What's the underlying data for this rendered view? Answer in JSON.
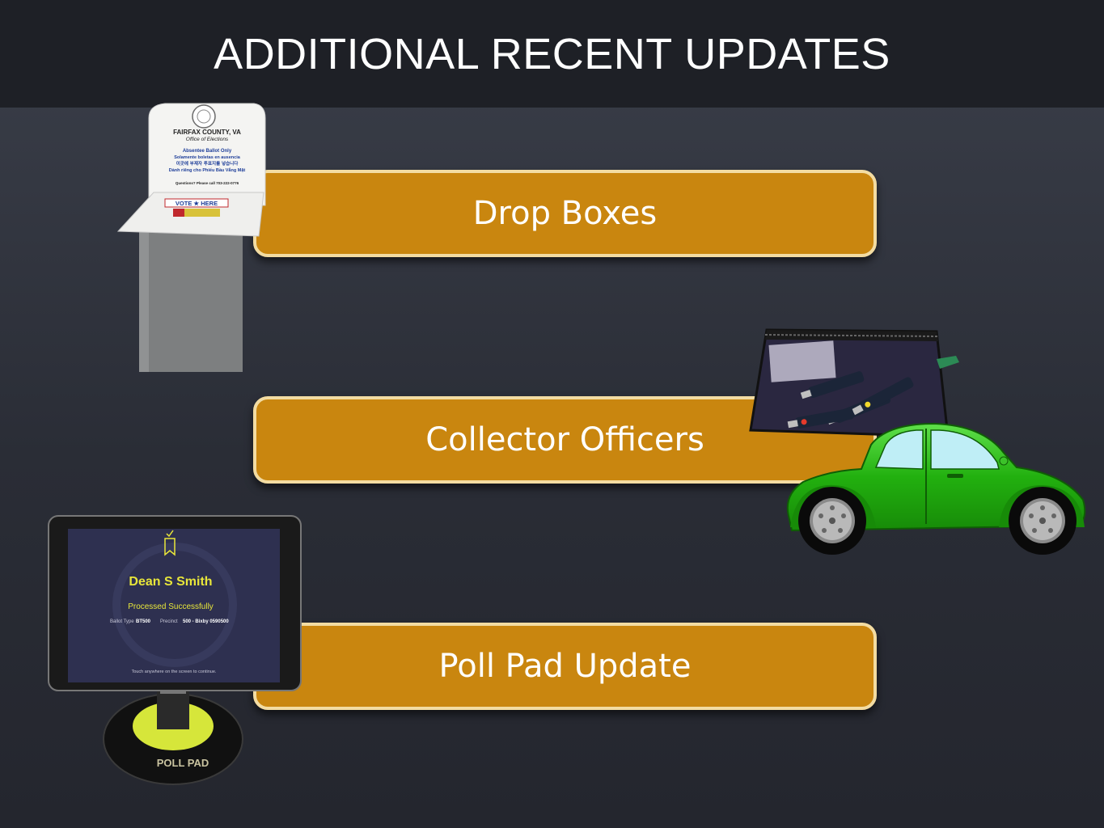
{
  "header": {
    "title": "ADDITIONAL RECENT UPDATES"
  },
  "items": [
    {
      "label": "Drop Boxes"
    },
    {
      "label": "Collector Officers"
    },
    {
      "label": "Poll Pad Update"
    }
  ],
  "dropbox": {
    "county": "FAIRFAX COUNTY, VA",
    "office": "Office of Elections",
    "line1": "Absentee Ballot Only",
    "line2": "Solamente boletas en ausencia",
    "line3": "이곳에 부재자 투표지를 넣습니다",
    "line4": "Dành riêng cho Phiếu Bầu Vắng Mặt",
    "questions": "Questions? Please call 703-222-0776",
    "vote": "VOTE ★ HERE"
  },
  "pollpad": {
    "voter_name": "Dean S Smith",
    "status": "Processed Successfully",
    "ballot_type_label": "Ballot Type",
    "ballot_type": "BT500",
    "precinct_label": "Precinct",
    "precinct": "500 - Bixby 0590500",
    "instruction": "Touch anywhere on the screen to continue.",
    "brand": "POLL PAD"
  },
  "colors": {
    "bar_fill": "#c9860f",
    "bar_border": "#f3dca2",
    "title_bg": "#1e2026",
    "car_body": "#22b00f",
    "pollpad_screen": "#2e3050",
    "pollpad_accent": "#e8e63a"
  }
}
